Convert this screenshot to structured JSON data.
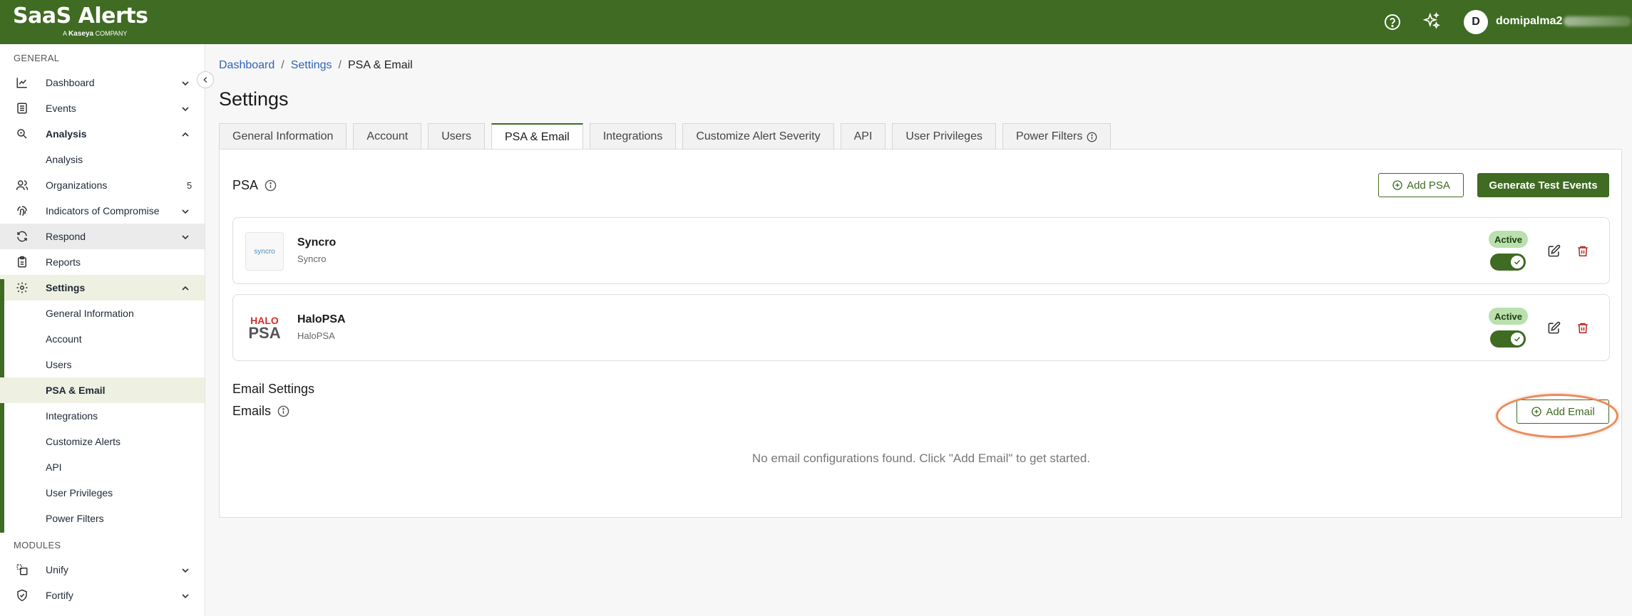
{
  "header": {
    "logo_main": "SaaS Alerts",
    "logo_sub_prefix": "A",
    "logo_sub_brand": "Kaseya",
    "logo_sub_suffix": "COMPANY",
    "avatar_initial": "D",
    "username": "domipalma2"
  },
  "sidebar": {
    "general_label": "GENERAL",
    "modules_label": "MODULES",
    "items": {
      "dashboard": "Dashboard",
      "events": "Events",
      "analysis": "Analysis",
      "analysis_sub": "Analysis",
      "organizations": "Organizations",
      "organizations_count": "5",
      "ioc": "Indicators of Compromise",
      "respond": "Respond",
      "reports": "Reports",
      "settings": "Settings",
      "general_information": "General Information",
      "account": "Account",
      "users": "Users",
      "psa_email": "PSA & Email",
      "integrations": "Integrations",
      "customize_alerts": "Customize Alerts",
      "api": "API",
      "user_privileges": "User Privileges",
      "power_filters": "Power Filters",
      "unify": "Unify",
      "fortify": "Fortify"
    }
  },
  "breadcrumb": {
    "dashboard": "Dashboard",
    "settings": "Settings",
    "current": "PSA & Email",
    "sep": "/"
  },
  "page_title": "Settings",
  "tabs": {
    "general_information": "General Information",
    "account": "Account",
    "users": "Users",
    "psa_email": "PSA & Email",
    "integrations": "Integrations",
    "customize_alert_severity": "Customize Alert Severity",
    "api": "API",
    "user_privileges": "User Privileges",
    "power_filters": "Power Filters"
  },
  "psa": {
    "title": "PSA",
    "add_psa_label": "Add PSA",
    "generate_test_events_label": "Generate Test Events",
    "integrations": [
      {
        "name": "Syncro",
        "sub": "Syncro",
        "status": "Active",
        "logo_text": "syncro"
      },
      {
        "name": "HaloPSA",
        "sub": "HaloPSA",
        "status": "Active",
        "logo_top": "HALO",
        "logo_bottom": "PSA"
      }
    ]
  },
  "email": {
    "section_title": "Email Settings",
    "emails_label": "Emails",
    "add_email_label": "Add Email",
    "empty_message": "No email configurations found. Click \"Add Email\" to get started."
  },
  "colors": {
    "brand_green": "#3f6b22",
    "active_badge": "#b9e0ad",
    "highlight": "#e88b5c",
    "danger": "#b3261e"
  }
}
